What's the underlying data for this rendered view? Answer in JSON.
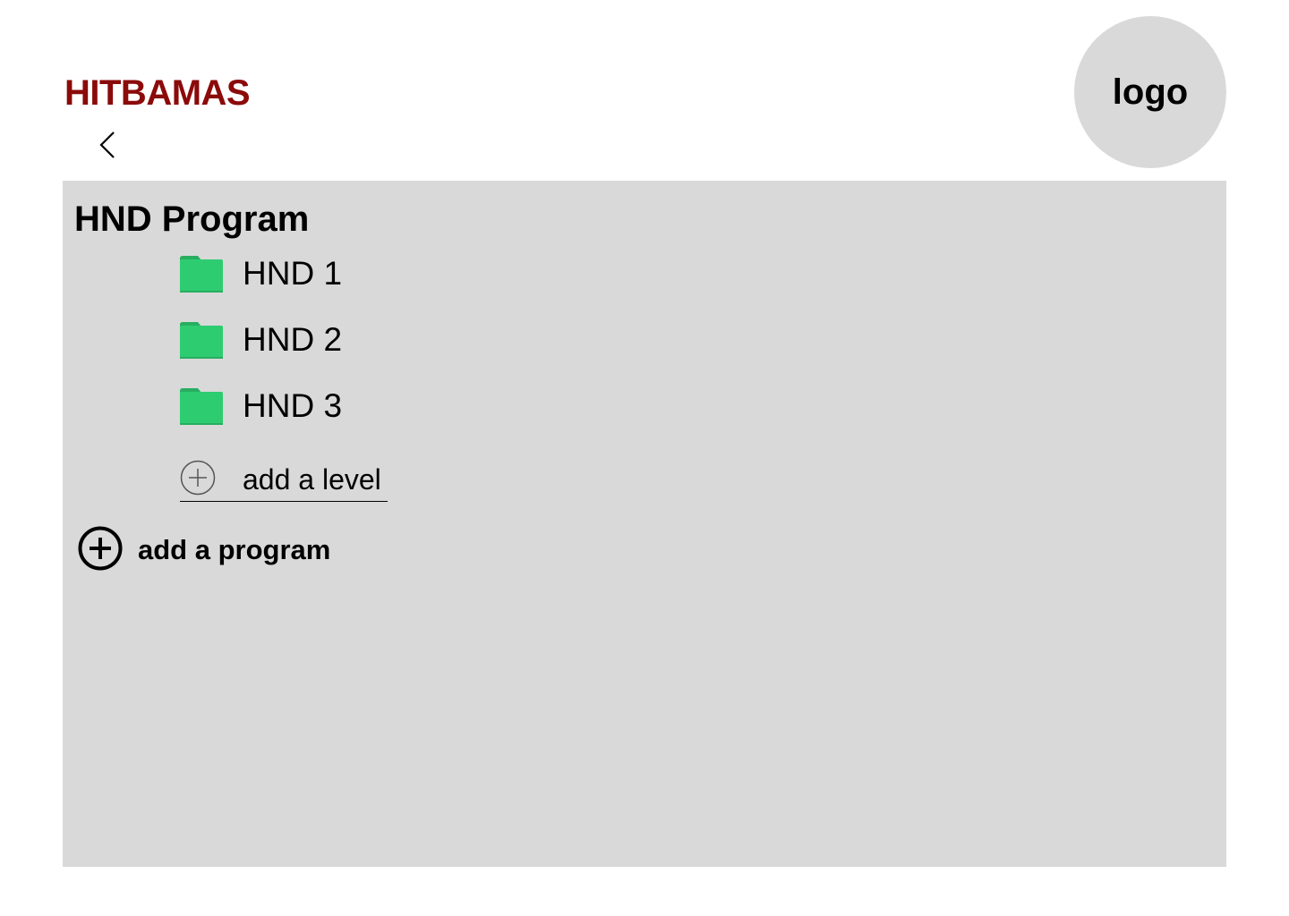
{
  "header": {
    "brand": "HITBAMAS",
    "logo_text": "logo",
    "back_icon": "chevron-left-icon"
  },
  "program": {
    "title": "HND Program",
    "levels": [
      {
        "label": "HND 1",
        "icon": "folder-icon"
      },
      {
        "label": "HND 2",
        "icon": "folder-icon"
      },
      {
        "label": "HND 3",
        "icon": "folder-icon"
      }
    ],
    "add_level_label": "add a level",
    "add_level_icon": "plus-circle-icon"
  },
  "actions": {
    "add_program_label": "add a program",
    "add_program_icon": "plus-circle-icon"
  },
  "colors": {
    "brand": "#8b0a0a",
    "panel": "#d9d9d9",
    "folder": "#2ecc71",
    "folder_tab": "#27ae60"
  }
}
